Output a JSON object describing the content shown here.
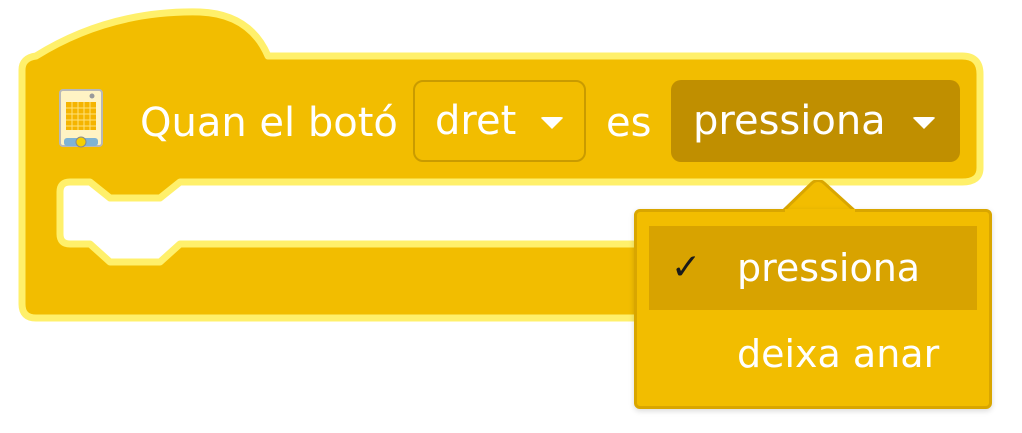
{
  "block": {
    "prefix_label": "Quan el botó",
    "button_value": "dret",
    "connector_label": "es",
    "state_value": "pressiona"
  },
  "menu": {
    "items": [
      {
        "label": "pressiona",
        "selected": true,
        "check_glyph": "✓"
      },
      {
        "label": "deixa anar",
        "selected": false
      }
    ]
  },
  "icons": {
    "board": "microbit-board-icon",
    "dropdown": "chevron-down-icon",
    "check": "checkmark-icon"
  },
  "colors": {
    "block_fill": "#F2BD00",
    "block_outline": "#FFF06B",
    "dropdown_dark": "#C08F00",
    "menu_selected": "#D8A300",
    "text": "#FFFFFF"
  }
}
